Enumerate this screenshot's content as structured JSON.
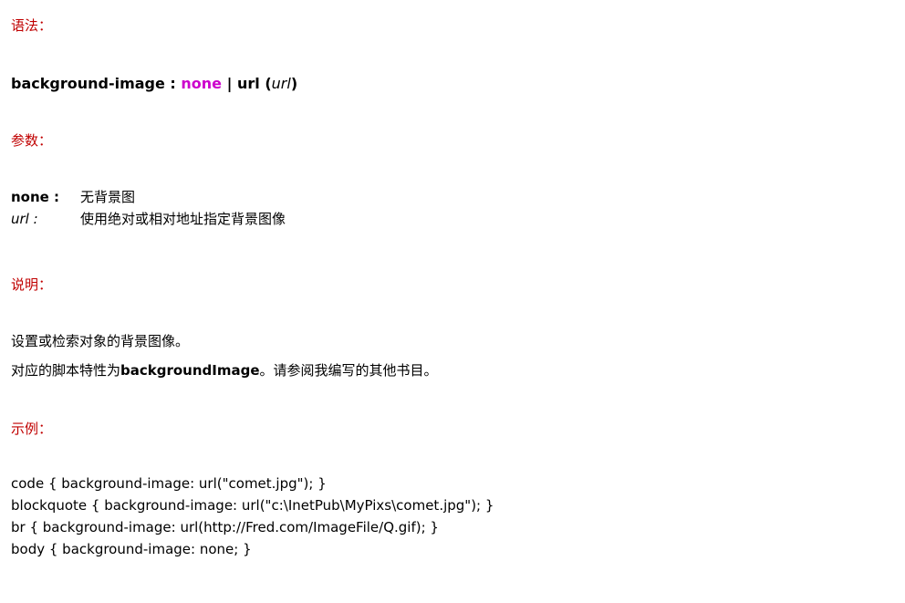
{
  "syntax_heading": "语法：",
  "syntax": {
    "property": "background-image",
    "colon": " : ",
    "none": "none",
    "sep": " | ",
    "url_kw": "url (",
    "url_arg": "url",
    "close": ")"
  },
  "params_heading": "参数：",
  "params": [
    {
      "term": "none :",
      "desc": "无背景图"
    },
    {
      "term": "url :",
      "desc": "使用绝对或相对地址指定背景图像"
    }
  ],
  "desc_heading": "说明：",
  "description": {
    "line1": "设置或检索对象的背景图像。",
    "line2_pre": "对应的脚本特性为",
    "line2_bold": "backgroundImage",
    "line2_post": "。请参阅我编写的其他书目。"
  },
  "example_heading": "示例：",
  "examples": [
    "code { background-image: url(\"comet.jpg\"); }",
    "blockquote { background-image: url(\"c:\\InetPub\\MyPixs\\comet.jpg\"); }",
    "br { background-image: url(http://Fred.com/ImageFile/Q.gif); }",
    "body { background-image: none; }"
  ],
  "colors": {
    "heading": "#c00000",
    "none_keyword": "#cc00cc"
  }
}
